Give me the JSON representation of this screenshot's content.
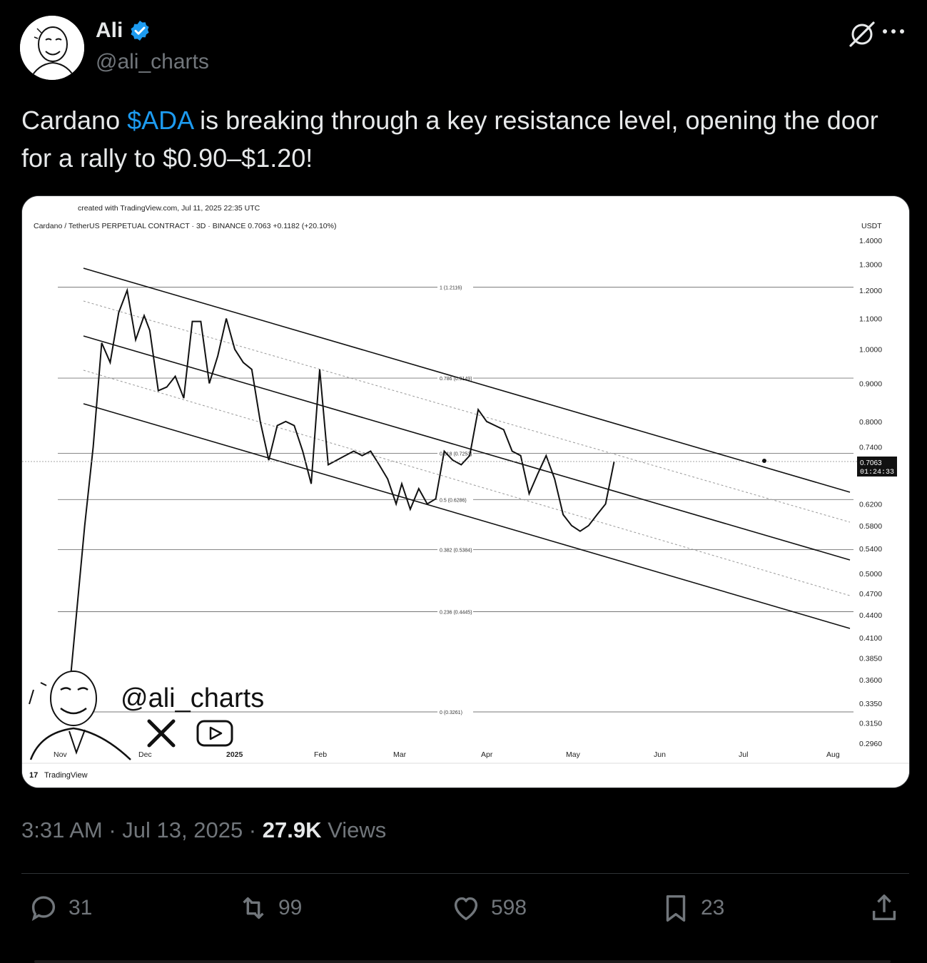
{
  "author": {
    "name": "Ali",
    "handle": "@ali_charts",
    "verified": true
  },
  "tweet": {
    "text_before": "Cardano ",
    "cashtag": "$ADA",
    "text_after": " is breaking through a key resistance level, opening the door for a rally to $0.90–$1.20!"
  },
  "meta": {
    "time": "3:31 AM · Jul 13, 2025 · ",
    "views_count": "27.9K",
    "views_label": " Views"
  },
  "actions": {
    "replies": "31",
    "reposts": "99",
    "likes": "598",
    "bookmarks": "23"
  },
  "colors": {
    "accent": "#1d9bf0",
    "secondary_text": "#71767b",
    "primary_text": "#e7e9ea"
  },
  "chart_data": {
    "type": "line",
    "created_with": "created with TradingView.com, Jul 11, 2025 22:35 UTC",
    "title": "Cardano / TetherUS PERPETUAL CONTRACT · 3D · BINANCE  0.7063  +0.1182 (+20.10%)",
    "y_unit": "USDT",
    "y_ticks": [
      "1.4000",
      "1.3000",
      "1.2000",
      "1.1000",
      "1.0000",
      "0.9000",
      "0.8000",
      "0.7400",
      "0.6200",
      "0.5800",
      "0.5400",
      "0.5000",
      "0.4700",
      "0.4400",
      "0.4100",
      "0.3850",
      "0.3600",
      "0.3350",
      "0.3150",
      "0.2960"
    ],
    "x_ticks": [
      "Nov",
      "Dec",
      "2025",
      "Feb",
      "Mar",
      "Apr",
      "May",
      "Jun",
      "Jul",
      "Aug"
    ],
    "fib_levels": [
      {
        "label": "1 (1.2116)",
        "value": 1.2116
      },
      {
        "label": "0.786 (0.9149)",
        "value": 0.9149
      },
      {
        "label": "0.618 (0.7253)",
        "value": 0.7253
      },
      {
        "label": "0.5 (0.6286)",
        "value": 0.6286
      },
      {
        "label": "0.382 (0.5384)",
        "value": 0.5384
      },
      {
        "label": "0.236 (0.4445)",
        "value": 0.4445
      },
      {
        "label": "0 (0.3261)",
        "value": 0.3261
      }
    ],
    "current_price": "0.7063",
    "countdown": "01:24:33",
    "series": [
      {
        "dates": [
          "2024-11-04",
          "2024-11-10",
          "2024-11-13",
          "2024-11-16",
          "2024-11-19",
          "2024-11-22",
          "2024-11-25",
          "2024-11-28",
          "2024-12-01",
          "2024-12-03",
          "2024-12-06",
          "2024-12-09",
          "2024-12-12",
          "2024-12-15",
          "2024-12-18",
          "2024-12-21",
          "2024-12-24",
          "2024-12-27",
          "2024-12-30",
          "2025-01-02",
          "2025-01-05",
          "2025-01-08",
          "2025-01-11",
          "2025-01-14",
          "2025-01-17",
          "2025-01-20",
          "2025-01-23",
          "2025-01-26",
          "2025-01-29",
          "2025-02-01",
          "2025-02-04",
          "2025-02-07",
          "2025-02-10",
          "2025-02-13",
          "2025-02-16",
          "2025-02-19",
          "2025-02-22",
          "2025-02-25",
          "2025-02-28",
          "2025-03-02",
          "2025-03-05",
          "2025-03-08",
          "2025-03-11",
          "2025-03-14",
          "2025-03-17",
          "2025-03-20",
          "2025-03-23",
          "2025-03-26",
          "2025-03-29",
          "2025-04-01",
          "2025-04-04",
          "2025-04-07",
          "2025-04-10",
          "2025-04-13",
          "2025-04-16",
          "2025-04-19",
          "2025-04-22",
          "2025-04-25",
          "2025-04-28",
          "2025-05-01",
          "2025-05-04",
          "2025-05-07",
          "2025-05-10",
          "2025-05-13",
          "2025-05-16",
          "2025-05-19",
          "2025-05-22",
          "2025-05-25",
          "2025-05-28",
          "2025-05-31",
          "2025-06-03",
          "2025-06-06",
          "2025-06-09",
          "2025-06-12",
          "2025-06-15",
          "2025-06-18",
          "2025-06-21",
          "2025-06-24",
          "2025-06-27",
          "2025-06-30",
          "2025-07-03",
          "2025-07-06",
          "2025-07-09",
          "2025-07-11"
        ],
        "values": [
          0.33,
          0.58,
          0.74,
          1.02,
          0.96,
          1.12,
          1.2,
          1.03,
          1.11,
          1.06,
          0.88,
          0.89,
          0.92,
          0.86,
          1.09,
          1.09,
          0.9,
          0.98,
          1.1,
          1.0,
          0.96,
          0.94,
          0.8,
          0.71,
          0.79,
          0.8,
          0.79,
          0.73,
          0.66,
          0.94,
          0.7,
          0.71,
          0.72,
          0.73,
          0.72,
          0.73,
          0.7,
          0.67,
          0.62,
          0.66,
          0.61,
          0.65,
          0.62,
          0.63,
          0.73,
          0.71,
          0.7,
          0.72,
          0.83,
          0.8,
          0.79,
          0.78,
          0.73,
          0.72,
          0.64,
          0.68,
          0.72,
          0.67,
          0.6,
          0.58,
          0.57,
          0.58,
          0.6,
          0.62,
          0.7063
        ]
      }
    ]
  },
  "watermark": {
    "handle": "@ali_charts"
  },
  "tradingview_label": "TradingView"
}
